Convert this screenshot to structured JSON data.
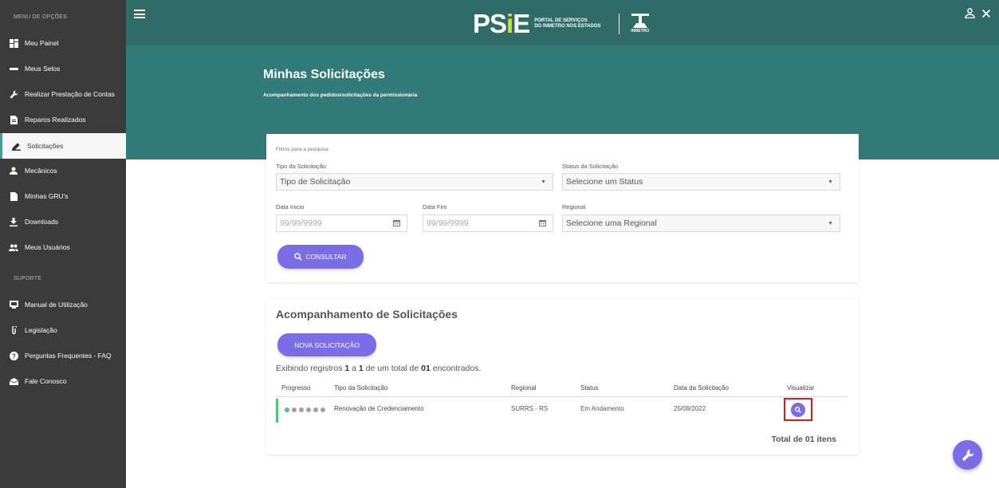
{
  "sidebar": {
    "menu_title": "MENU DE OPÇÕES",
    "support_title": "SUPORTE",
    "items": [
      {
        "label": "Meu Painel",
        "icon": "dashboard-icon"
      },
      {
        "label": "Meus Selos",
        "icon": "seal-icon"
      },
      {
        "label": "Realizar Prestação de Contas",
        "icon": "wrench-icon"
      },
      {
        "label": "Reparos Realizados",
        "icon": "document-icon"
      },
      {
        "label": "Solicitações",
        "icon": "pen-icon",
        "active": true
      },
      {
        "label": "Mecânicos",
        "icon": "person-icon"
      },
      {
        "label": "Minhas GRU's",
        "icon": "file-icon"
      },
      {
        "label": "Downloads",
        "icon": "download-icon"
      },
      {
        "label": "Meus Usuários",
        "icon": "users-icon"
      }
    ],
    "support_items": [
      {
        "label": "Manual de Utilização",
        "icon": "book-icon"
      },
      {
        "label": "Legislação",
        "icon": "paperclip-icon"
      },
      {
        "label": "Perguntas Frequentes - FAQ",
        "icon": "question-icon"
      },
      {
        "label": "Fale Conosco",
        "icon": "mail-icon"
      }
    ]
  },
  "header": {
    "logo_main": "PS",
    "logo_i": "i",
    "logo_e": "E",
    "logo_line1": "PORTAL DE SERVIÇOS",
    "logo_line2": "DO INMETRO NOS ESTADOS",
    "inmetro_label": "INMETRO"
  },
  "banner": {
    "title": "Minhas Solicitações",
    "subtitle": "Acompanhamento dos pedidos/solicitações da permissionária"
  },
  "filters": {
    "caption": "Filtros para a pesquisa",
    "tipo_label": "Tipo da Solicitação",
    "tipo_value": "Tipo de Solicitação",
    "status_label": "Status da Solicitação",
    "status_value": "Selecione um Status",
    "inicio_label": "Data Inicio",
    "inicio_placeholder": "99/99/9999",
    "fim_label": "Data Fim",
    "fim_placeholder": "99/99/9999",
    "regional_label": "Regional",
    "regional_value": "Selecione uma Regional",
    "consultar_label": "CONSULTAR"
  },
  "results": {
    "title": "Acompanhamento de Solicitações",
    "nova_label": "NOVA SOLICITAÇÃO",
    "summary_pre": "Exibindo registros ",
    "summary_from": "1",
    "summary_mid1": " a ",
    "summary_to": "1",
    "summary_mid2": " de um total de ",
    "summary_total": "01",
    "summary_post": " encontrados.",
    "columns": [
      "Progresso",
      "Tipo da Solicitação",
      "Regional",
      "Status",
      "Data da Solicitação",
      "Visualizar"
    ],
    "rows": [
      {
        "progress_steps": 6,
        "progress_done": 1,
        "tipo": "Renovação de Credenciamento",
        "regional": "SURRS - RS",
        "status": "Em Andamento",
        "data": "25/08/2022"
      }
    ],
    "total": "Total de 01 itens"
  },
  "colors": {
    "sidebar": "#3b3b3b",
    "header": "#2f6b67",
    "banner": "#337b78",
    "accent": "#7b6de6",
    "progress_on": "#4fb8b1",
    "highlight": "#e01818"
  }
}
